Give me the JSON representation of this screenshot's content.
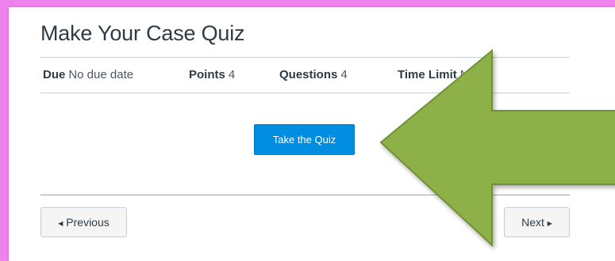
{
  "quiz": {
    "title": "Make Your Case Quiz",
    "meta": [
      {
        "label": "Due",
        "value": "No due date"
      },
      {
        "label": "Points",
        "value": "4"
      },
      {
        "label": "Questions",
        "value": "4"
      },
      {
        "label": "Time Limit",
        "value": "None"
      }
    ],
    "take_button": "Take the Quiz"
  },
  "navigation": {
    "previous_label": "Previous",
    "next_label": "Next",
    "previous_caret": "◀",
    "next_caret": "▶"
  },
  "colors": {
    "background": "#ee82ee",
    "accent_button": "#008ee2",
    "arrow_fill": "#8db048",
    "arrow_stroke": "#6f9233"
  }
}
